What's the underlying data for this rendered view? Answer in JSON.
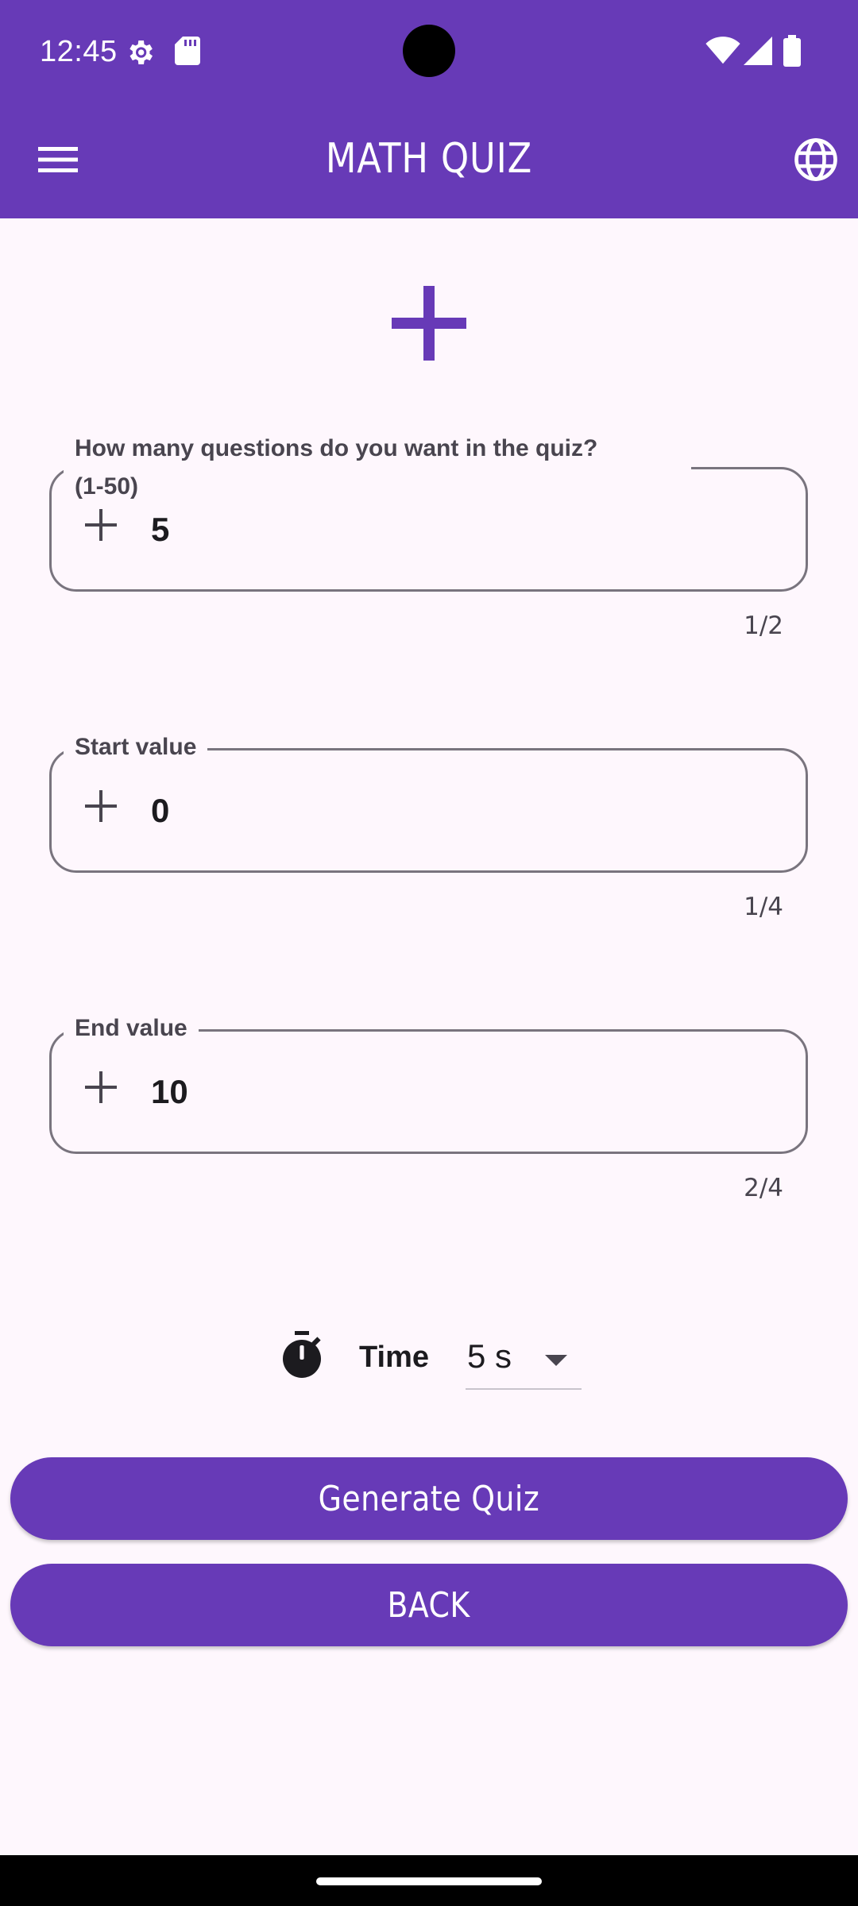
{
  "status_bar": {
    "time": "12:45",
    "icons": [
      "settings-gear-icon",
      "sd-card-icon",
      "wifi-icon",
      "cell-signal-icon",
      "battery-icon"
    ]
  },
  "app_bar": {
    "title": "MATH QUIZ",
    "left_icon": "menu-icon",
    "right_icon": "globe-icon",
    "background_color": "#673ab7"
  },
  "operation": {
    "icon": "plus-icon",
    "color": "#673ab7"
  },
  "fields": [
    {
      "label_line1": "How many questions do you want in the quiz?",
      "label_line2": "(1-50)",
      "value": "5",
      "counter": "1/2"
    },
    {
      "label": "Start value",
      "value": "0",
      "counter": "1/4"
    },
    {
      "label": "End value",
      "value": "10",
      "counter": "2/4"
    }
  ],
  "time": {
    "label": "Time",
    "selected": "5 s",
    "icon": "stopwatch-icon"
  },
  "buttons": {
    "generate": "Generate Quiz",
    "back": "BACK"
  },
  "colors": {
    "primary": "#673ab7",
    "background": "#fef7fd",
    "outline": "#79747e"
  }
}
